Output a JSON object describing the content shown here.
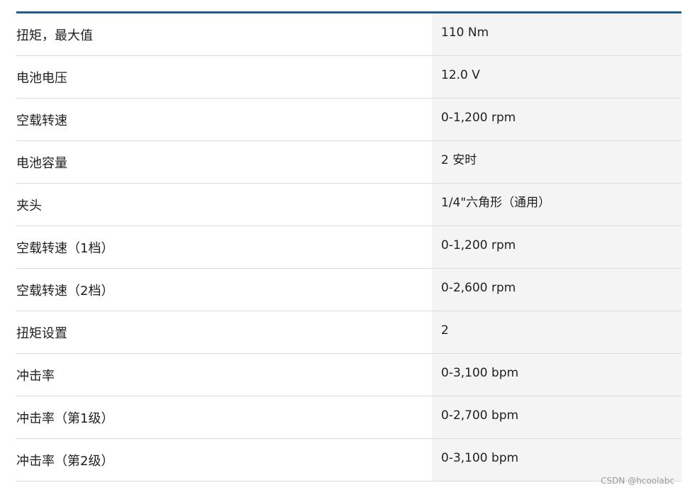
{
  "specs": [
    {
      "label": "扭矩，最大值",
      "value": "110 Nm"
    },
    {
      "label": "电池电压",
      "value": "12.0 V"
    },
    {
      "label": "空载转速",
      "value": "0-1,200 rpm"
    },
    {
      "label": "电池容量",
      "value": "2 安时"
    },
    {
      "label": "夹头",
      "value": "1/4\"六角形（通用）"
    },
    {
      "label": "空载转速（1档）",
      "value": "0-1,200 rpm"
    },
    {
      "label": "空载转速（2档）",
      "value": "0-2,600 rpm"
    },
    {
      "label": "扭矩设置",
      "value": "2"
    },
    {
      "label": "冲击率",
      "value": "0-3,100 bpm"
    },
    {
      "label": "冲击率（第1级）",
      "value": "0-2,700 bpm"
    },
    {
      "label": "冲击率（第2级）",
      "value": "0-3,100 bpm"
    }
  ],
  "watermark": "CSDN @hcoolabc",
  "colors": {
    "header_rule": "#1f5b8f",
    "value_column_bg": "#f4f4f4",
    "row_divider": "#dadada"
  }
}
